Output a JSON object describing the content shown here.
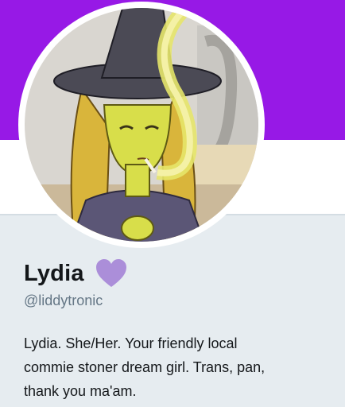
{
  "profile": {
    "display_name": "Lydia",
    "handle": "@liddytronic",
    "bio_lines": [
      "Lydia. She/Her. Your friendly local",
      "commie stoner dream girl. Trans, pan,",
      "thank you ma'am."
    ],
    "badge_icon": "purple-heart-icon"
  },
  "colors": {
    "banner": "#9719e6",
    "heart": "#ab8ed9",
    "page_background": "#e6ecf0",
    "handle_text": "#657786"
  }
}
